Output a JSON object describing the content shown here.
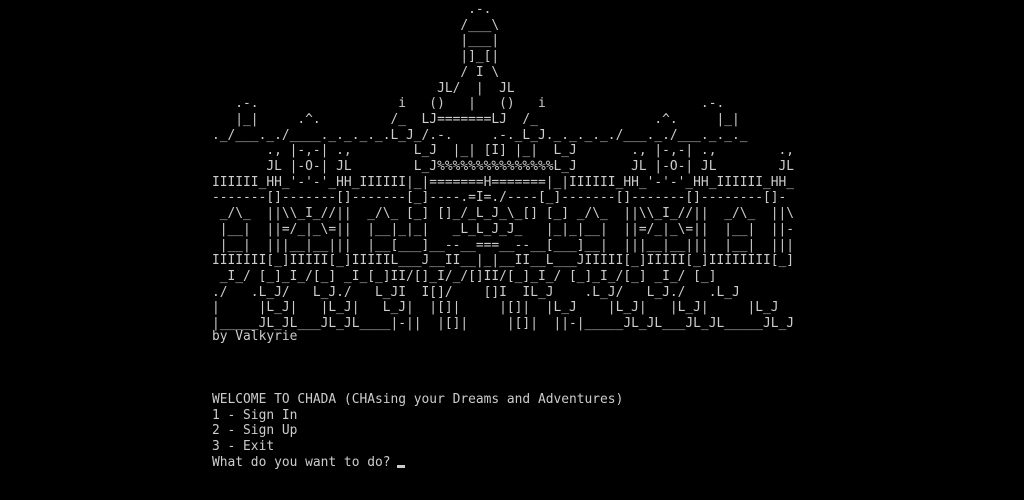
{
  "ascii_art": [
    "                                 .-.",
    "                                /___\\",
    "                                |___|",
    "                                |]_[|",
    "                                / I \\",
    "                             JL/  |  JL",
    "   .-.                  i   ()   |   ()   i                    .-.",
    "   |_|     .^.         /_  LJ=======LJ  /_               .^.     |_|",
    "._/___._./____._._._._.L_J_/.-.     .-._L_J._._._._./___._./___._._._",
    "       ., |-,-| .,        L_J  |_| [I] |_|  L_J       ., |-,-| .,        .,",
    "       JL |-O-| JL        L_J%%%%%%%%%%%%%%%L_J       JL |-O-| JL        JL",
    "IIIIII_HH_'-'-'_HH_IIIIII|_|=======H=======|_|IIIIII_HH_'-'-'_HH_IIIIII_HH_",
    "-------[]-------[]-------[_]----.=I=./----[_]-------[]-------[]--------[]-",
    " _/\\_  ||\\\\_I_//||  _/\\_ [_] []_/_L_J_\\_[] [_] _/\\_  ||\\\\_I_//||  _/\\_  ||\\",
    " |__|  ||=/_|_\\=||  |__|_|_|   _L_L_J_J_   |_|_|__|  ||=/_|_\\=||  |__|  ||-",
    " |__|  |||__|__|||  |__[___]__--__===__--__[___]__|  |||__|__|||  |__|  |||",
    "IIIIIII[_]IIIII[_]IIIIIL___J__II__|_|__II__L___JIIIII[_]IIIII[_]IIIIIIII[_]",
    " _I_/ [_]_I_/[_] _I_[_]II/[]_I/_/[]II/[_]_I_/ [_]_I_/[_] _I_/ [_]",
    "./   .L_J/   L_J./   L_JI  I[]/    []I  IL_J    .L_J/   L_J./   .L_J",
    "|     |L_J|   |L_J|   L_J|  |[]|     |[]|  |L_J    |L_J|   |L_J|     |L_J",
    "|_____JL_JL___JL_JL____|-||  |[]|     |[]|  ||-|_____JL_JL___JL_JL_____JL_J"
  ],
  "credit": "by Valkyrie",
  "menu": {
    "welcome": "WELCOME TO CHADA (CHAsing your Dreams and Adventures)",
    "option_1": "1 - Sign In",
    "option_2": "2 - Sign Up",
    "option_3": "3 - Exit",
    "prompt": "What do you want to do?"
  }
}
